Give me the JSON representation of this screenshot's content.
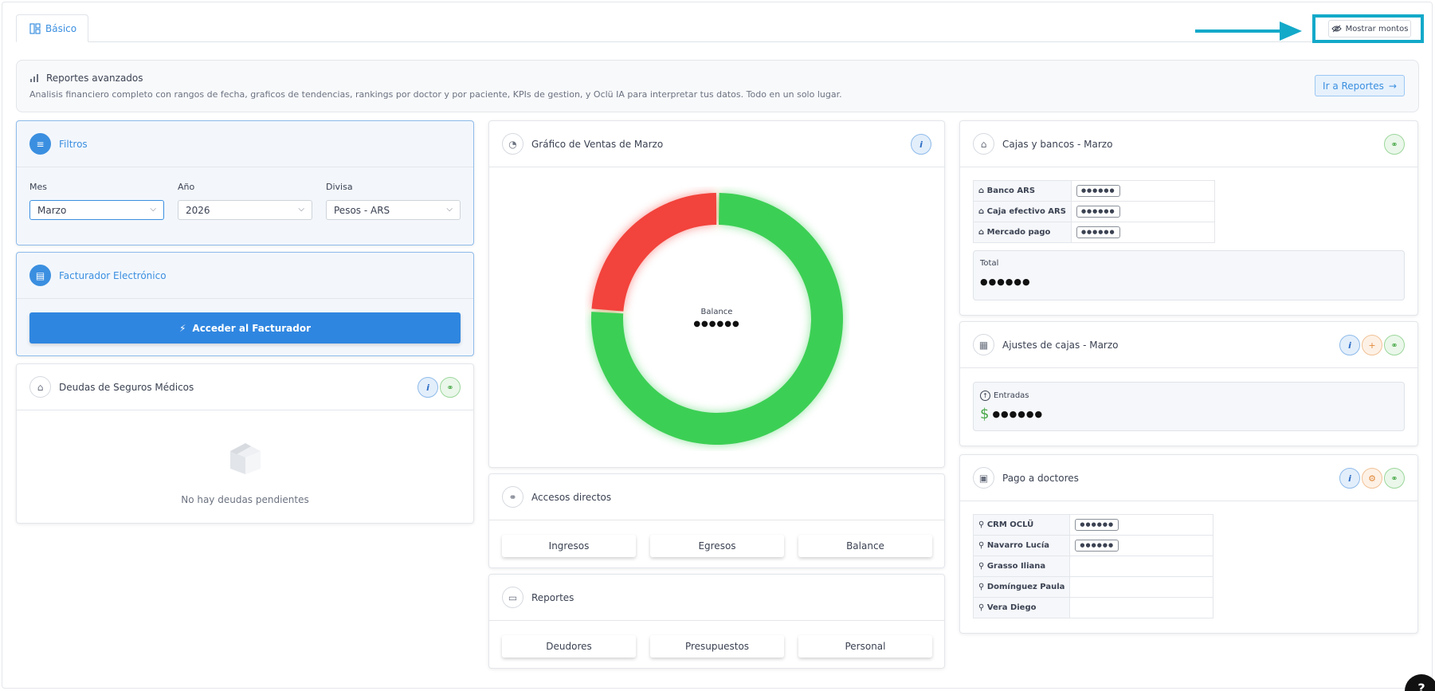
{
  "tabs": [
    {
      "label": "Básico",
      "icon": "layout-icon"
    }
  ],
  "toolbar": {
    "show_amounts_label": "Mostrar montos"
  },
  "banner": {
    "title": "Reportes avanzados",
    "description": "Analisis financiero completo con rangos de fecha, graficos de tendencias, rankings por doctor y por paciente, KPIs de gestion, y Oclü IA para interpretar tus datos. Todo en un solo lugar.",
    "button_label": "Ir a Reportes"
  },
  "filters": {
    "title": "Filtros",
    "month": {
      "label": "Mes",
      "value": "Marzo"
    },
    "year": {
      "label": "Año",
      "value": "2026"
    },
    "currency": {
      "label": "Divisa",
      "value": "Pesos - ARS"
    }
  },
  "invoicer": {
    "title": "Facturador Electrónico",
    "button_label": "Acceder al Facturador"
  },
  "insurance_debts": {
    "title": "Deudas de Seguros Médicos",
    "empty_text": "No hay deudas pendientes"
  },
  "sales_chart": {
    "title": "Gráfico de Ventas de Marzo",
    "center_label": "Balance",
    "center_value": "●●●●●●"
  },
  "chart_data": {
    "type": "pie",
    "title": "Gráfico de Ventas de Marzo",
    "slices": [
      {
        "name": "",
        "value": 76,
        "color": "#3ccf55"
      },
      {
        "name": "",
        "value": 24,
        "color": "#f2433c"
      }
    ]
  },
  "shortcuts": {
    "title": "Accesos directos",
    "buttons": [
      "Ingresos",
      "Egresos",
      "Balance"
    ]
  },
  "reports": {
    "title": "Reportes",
    "buttons": [
      "Deudores",
      "Presupuestos",
      "Personal"
    ]
  },
  "banks": {
    "title": "Cajas y bancos - Marzo",
    "rows": [
      {
        "name": "Banco ARS",
        "value": "●●●●●●"
      },
      {
        "name": "Caja efectivo ARS",
        "value": "●●●●●●"
      },
      {
        "name": "Mercado pago",
        "value": "●●●●●●"
      }
    ],
    "total_label": "Total",
    "total_value": "●●●●●●"
  },
  "adjustments": {
    "title": "Ajustes de cajas - Marzo",
    "entries_label": "Entradas",
    "currency_symbol": "$",
    "entries_value": "●●●●●●"
  },
  "doctor_payments": {
    "title": "Pago a doctores",
    "rows": [
      {
        "name": "CRM OCLÜ",
        "value": "●●●●●●"
      },
      {
        "name": "Navarro Lucía",
        "value": "●●●●●●"
      },
      {
        "name": "Grasso Iliana",
        "value": ""
      },
      {
        "name": "Domínguez Paula",
        "value": ""
      },
      {
        "name": "Vera Diego",
        "value": ""
      }
    ]
  },
  "help": {
    "label": "?"
  },
  "colors": {
    "accent": "#3b8fe0",
    "highlight": "#13a9c9",
    "positive": "#3ccf55",
    "negative": "#f2433c"
  }
}
